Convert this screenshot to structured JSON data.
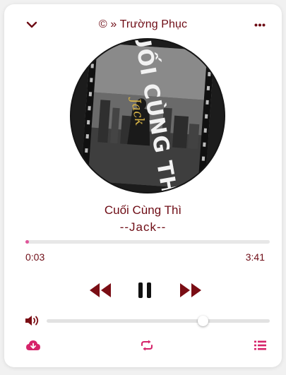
{
  "header": {
    "title": "© » Trường Phục",
    "collapse_icon": "chevron-down-icon",
    "menu_icon": "more-horizontal-icon"
  },
  "album": {
    "cover_text_main": "CUỐI CÙNG THÌ",
    "cover_text_script": "Jack"
  },
  "song": {
    "title": "Cuối Cùng Thì",
    "artist": "--Jack--"
  },
  "progress": {
    "current_time": "0:03",
    "duration": "3:41",
    "fraction": 0.014
  },
  "controls": {
    "previous_icon": "rewind-icon",
    "play_pause_icon": "pause-icon",
    "next_icon": "fast-forward-icon"
  },
  "volume": {
    "icon": "volume-icon",
    "level": 0.7
  },
  "footer": {
    "download_icon": "cloud-download-icon",
    "repeat_icon": "repeat-icon",
    "playlist_icon": "playlist-icon"
  },
  "colors": {
    "accent": "#6e0c15",
    "pink": "#e0559a",
    "footer_icon": "#d6236a"
  }
}
